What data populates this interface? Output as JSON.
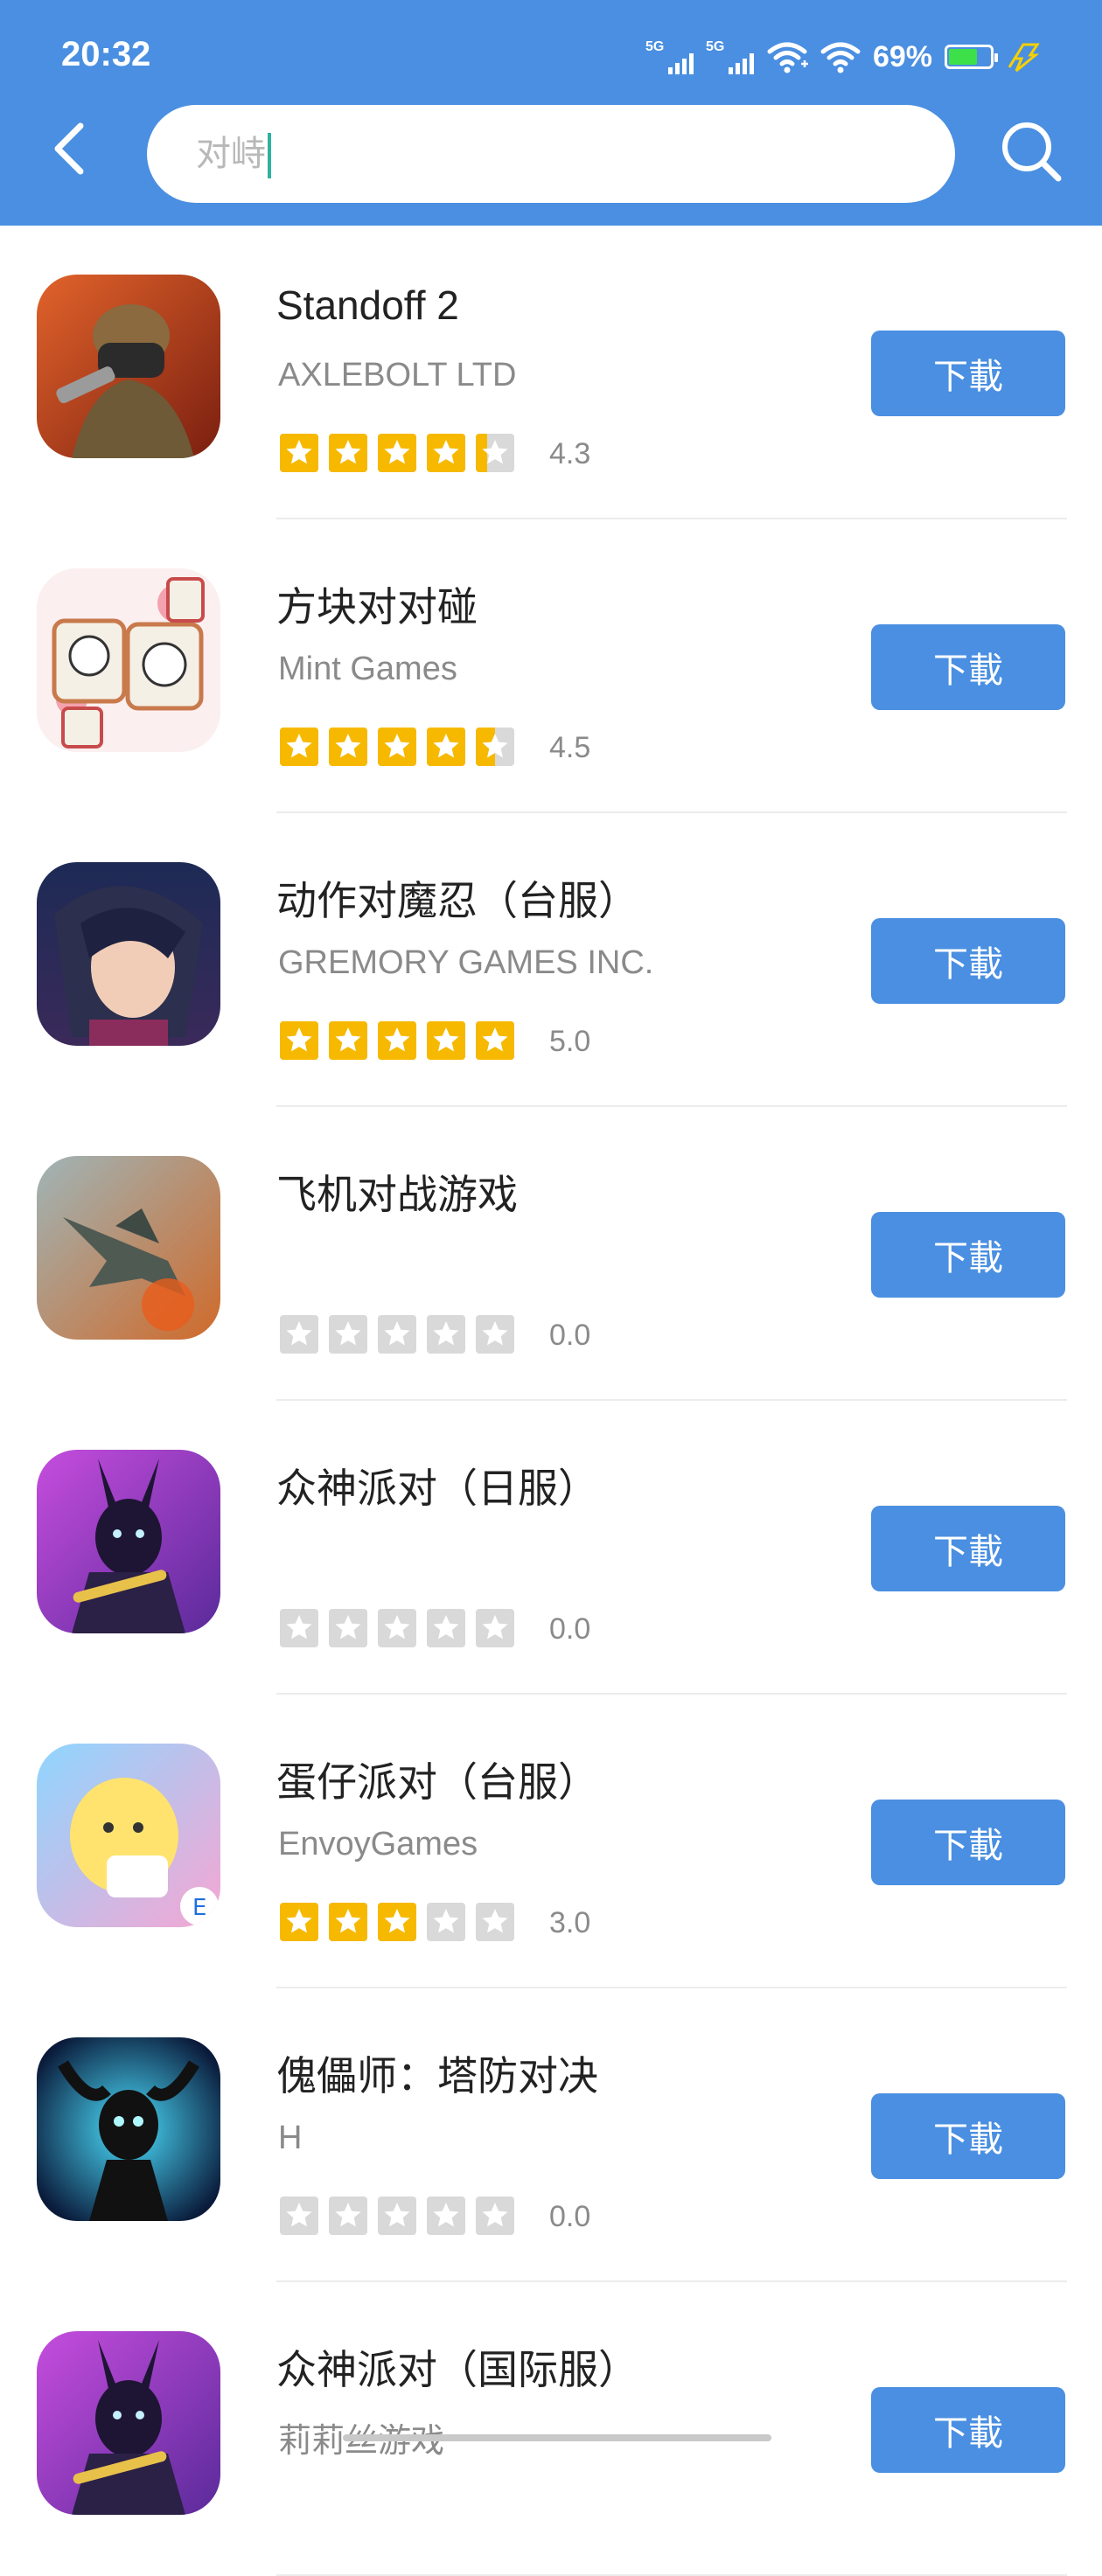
{
  "status_bar": {
    "time": "20:32",
    "battery_percent": "69%",
    "network1": "5G",
    "network2": "5G",
    "battery_level": 0.69
  },
  "search": {
    "query": "对峙"
  },
  "colors": {
    "header": "#4a8fe1",
    "button": "#4a8fe1",
    "star": "#f7b900",
    "star_empty": "#d9d9d9"
  },
  "apps": [
    {
      "name": "Standoff 2",
      "developer": "AXLEBOLT LTD",
      "rating": "4.3",
      "stars": 4.3,
      "button": "下載",
      "icon": "soldier-game-icon"
    },
    {
      "name": "方块对对碰",
      "developer": "Mint Games",
      "rating": "4.5",
      "stars": 4.5,
      "button": "下載",
      "icon": "mahjong-tiles-icon"
    },
    {
      "name": "动作对魔忍（台服）",
      "developer": "GREMORY GAMES INC.",
      "rating": "5.0",
      "stars": 5.0,
      "button": "下載",
      "icon": "anime-ninja-icon"
    },
    {
      "name": "飞机对战游戏",
      "developer": "",
      "rating": "0.0",
      "stars": 0,
      "button": "下載",
      "icon": "fighter-jet-icon"
    },
    {
      "name": "众神派对（日服）",
      "developer": "",
      "rating": "0.0",
      "stars": 0,
      "button": "下載",
      "icon": "anubis-icon"
    },
    {
      "name": "蛋仔派对（台服）",
      "developer": "EnvoyGames",
      "rating": "3.0",
      "stars": 3.0,
      "button": "下載",
      "icon": "eggy-party-icon"
    },
    {
      "name": "傀儡师：塔防对决",
      "developer": "H",
      "rating": "0.0",
      "stars": 0,
      "button": "下載",
      "icon": "horned-puppet-icon"
    },
    {
      "name": "众神派对（国际服）",
      "developer": "莉莉丝游戏",
      "rating": "",
      "stars": 0,
      "button": "下載",
      "icon": "anubis-icon"
    }
  ]
}
